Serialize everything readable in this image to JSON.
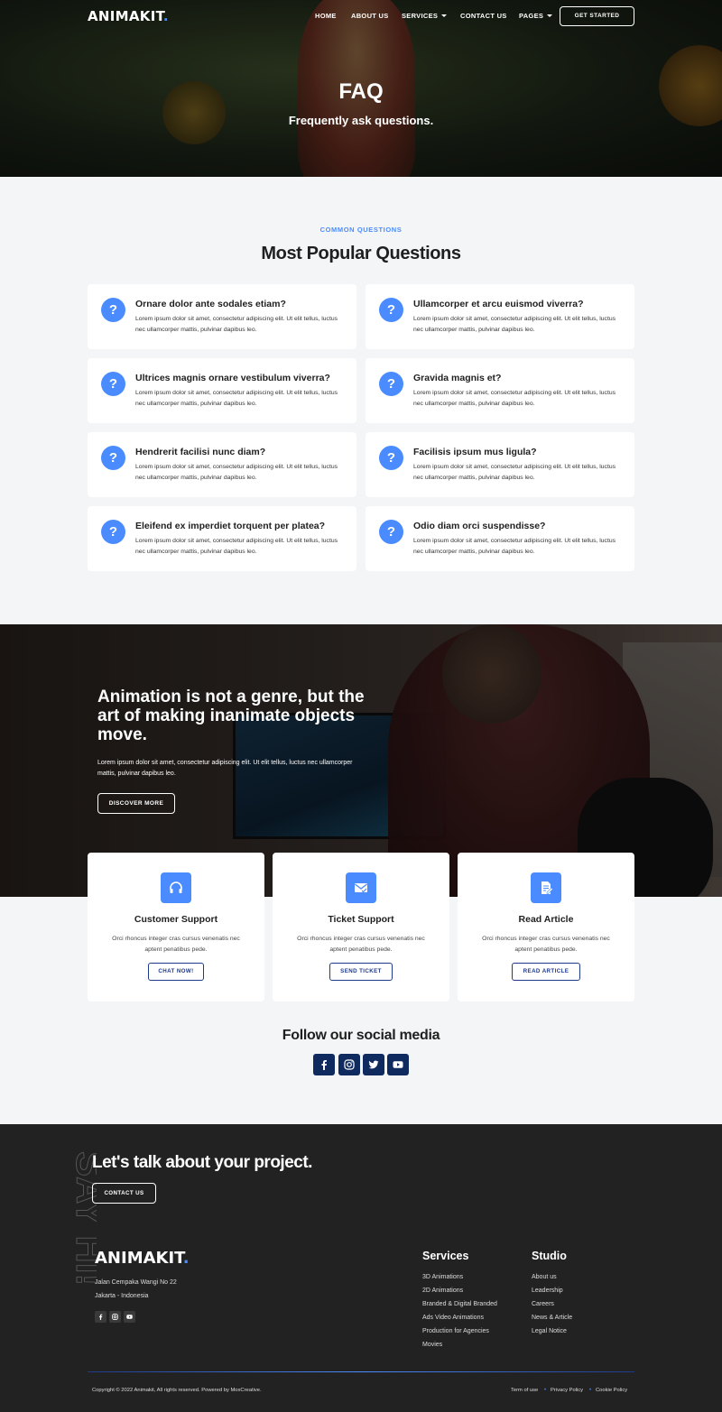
{
  "brand": {
    "name": "ANIMAKIT",
    "dot": "."
  },
  "nav": {
    "items": [
      {
        "label": "HOME"
      },
      {
        "label": "ABOUT US"
      },
      {
        "label": "SERVICES"
      },
      {
        "label": "CONTACT US"
      },
      {
        "label": "PAGES"
      }
    ],
    "cta": "GET STARTED"
  },
  "hero": {
    "title": "FAQ",
    "subtitle": "Frequently ask questions."
  },
  "faq": {
    "eyebrow": "COMMON QUESTIONS",
    "title": "Most Popular Questions",
    "icon": "question-icon",
    "items": [
      {
        "q": "Ornare dolor ante sodales etiam?",
        "a": "Lorem ipsum dolor sit amet, consectetur adipiscing elit. Ut elit tellus, luctus nec ullamcorper mattis, pulvinar dapibus leo."
      },
      {
        "q": "Ullamcorper et arcu euismod viverra?",
        "a": "Lorem ipsum dolor sit amet, consectetur adipiscing elit. Ut elit tellus, luctus nec ullamcorper mattis, pulvinar dapibus leo."
      },
      {
        "q": "Ultrices magnis ornare vestibulum viverra?",
        "a": "Lorem ipsum dolor sit amet, consectetur adipiscing elit. Ut elit tellus, luctus nec ullamcorper mattis, pulvinar dapibus leo."
      },
      {
        "q": "Gravida magnis et?",
        "a": "Lorem ipsum dolor sit amet, consectetur adipiscing elit. Ut elit tellus, luctus nec ullamcorper mattis, pulvinar dapibus leo."
      },
      {
        "q": "Hendrerit facilisi nunc diam?",
        "a": "Lorem ipsum dolor sit amet, consectetur adipiscing elit. Ut elit tellus, luctus nec ullamcorper mattis, pulvinar dapibus leo."
      },
      {
        "q": "Facilisis ipsum mus ligula?",
        "a": "Lorem ipsum dolor sit amet, consectetur adipiscing elit. Ut elit tellus, luctus nec ullamcorper mattis, pulvinar dapibus leo."
      },
      {
        "q": "Eleifend ex imperdiet torquent per platea?",
        "a": "Lorem ipsum dolor sit amet, consectetur adipiscing elit. Ut elit tellus, luctus nec ullamcorper mattis, pulvinar dapibus leo."
      },
      {
        "q": "Odio diam orci suspendisse?",
        "a": "Lorem ipsum dolor sit amet, consectetur adipiscing elit. Ut elit tellus, luctus nec ullamcorper mattis, pulvinar dapibus leo."
      }
    ]
  },
  "banner": {
    "title": "Animation is not a genre, but the art of making inanimate objects move.",
    "text": "Lorem ipsum dolor sit amet, consectetur adipiscing elit. Ut elit tellus, luctus nec ullamcorper mattis, pulvinar dapibus leo.",
    "button": "DISCOVER MORE"
  },
  "support": [
    {
      "icon": "headphones-icon",
      "title": "Customer Support",
      "text": "Orci rhoncus integer cras cursus venenatis nec aptent penatibus pede.",
      "button": "CHAT NOW!"
    },
    {
      "icon": "ticket-mail-icon",
      "title": "Ticket Support",
      "text": "Orci rhoncus integer cras cursus venenatis nec aptent penatibus pede.",
      "button": "SEND TICKET"
    },
    {
      "icon": "document-edit-icon",
      "title": "Read Article",
      "text": "Orci rhoncus integer cras cursus venenatis nec aptent penatibus pede.",
      "button": "READ ARTICLE"
    }
  ],
  "social": {
    "title": "Follow our social media",
    "icons": [
      "facebook-icon",
      "instagram-icon",
      "twitter-icon",
      "youtube-icon"
    ]
  },
  "footer": {
    "sayhi": "SAY HI!",
    "talk": "Let's talk about your project.",
    "contact_button": "CONTACT US",
    "address_line1": "Jalan Cempaka Wangi No 22",
    "address_line2": "Jakarta - Indonesia",
    "services_title": "Services",
    "services": [
      "3D Animations",
      "2D Animations",
      "Branded & Digital Branded",
      "Ads Video Animations",
      "Production for Agencies",
      "Movies"
    ],
    "studio_title": "Studio",
    "studio": [
      "About us",
      "Leadership",
      "Careers",
      "News & Article",
      "Legal Notice"
    ],
    "copyright": "Copyright © 2022 Animakit, All rights reserved. Powered by MoxCreative.",
    "legal": [
      "Term of use",
      "Privacy Policy",
      "Cookie Policy"
    ]
  },
  "colors": {
    "accent": "#4a8cff",
    "navy": "#0f2a5e",
    "footer_bg": "#222222",
    "page_bg": "#f4f5f7"
  }
}
